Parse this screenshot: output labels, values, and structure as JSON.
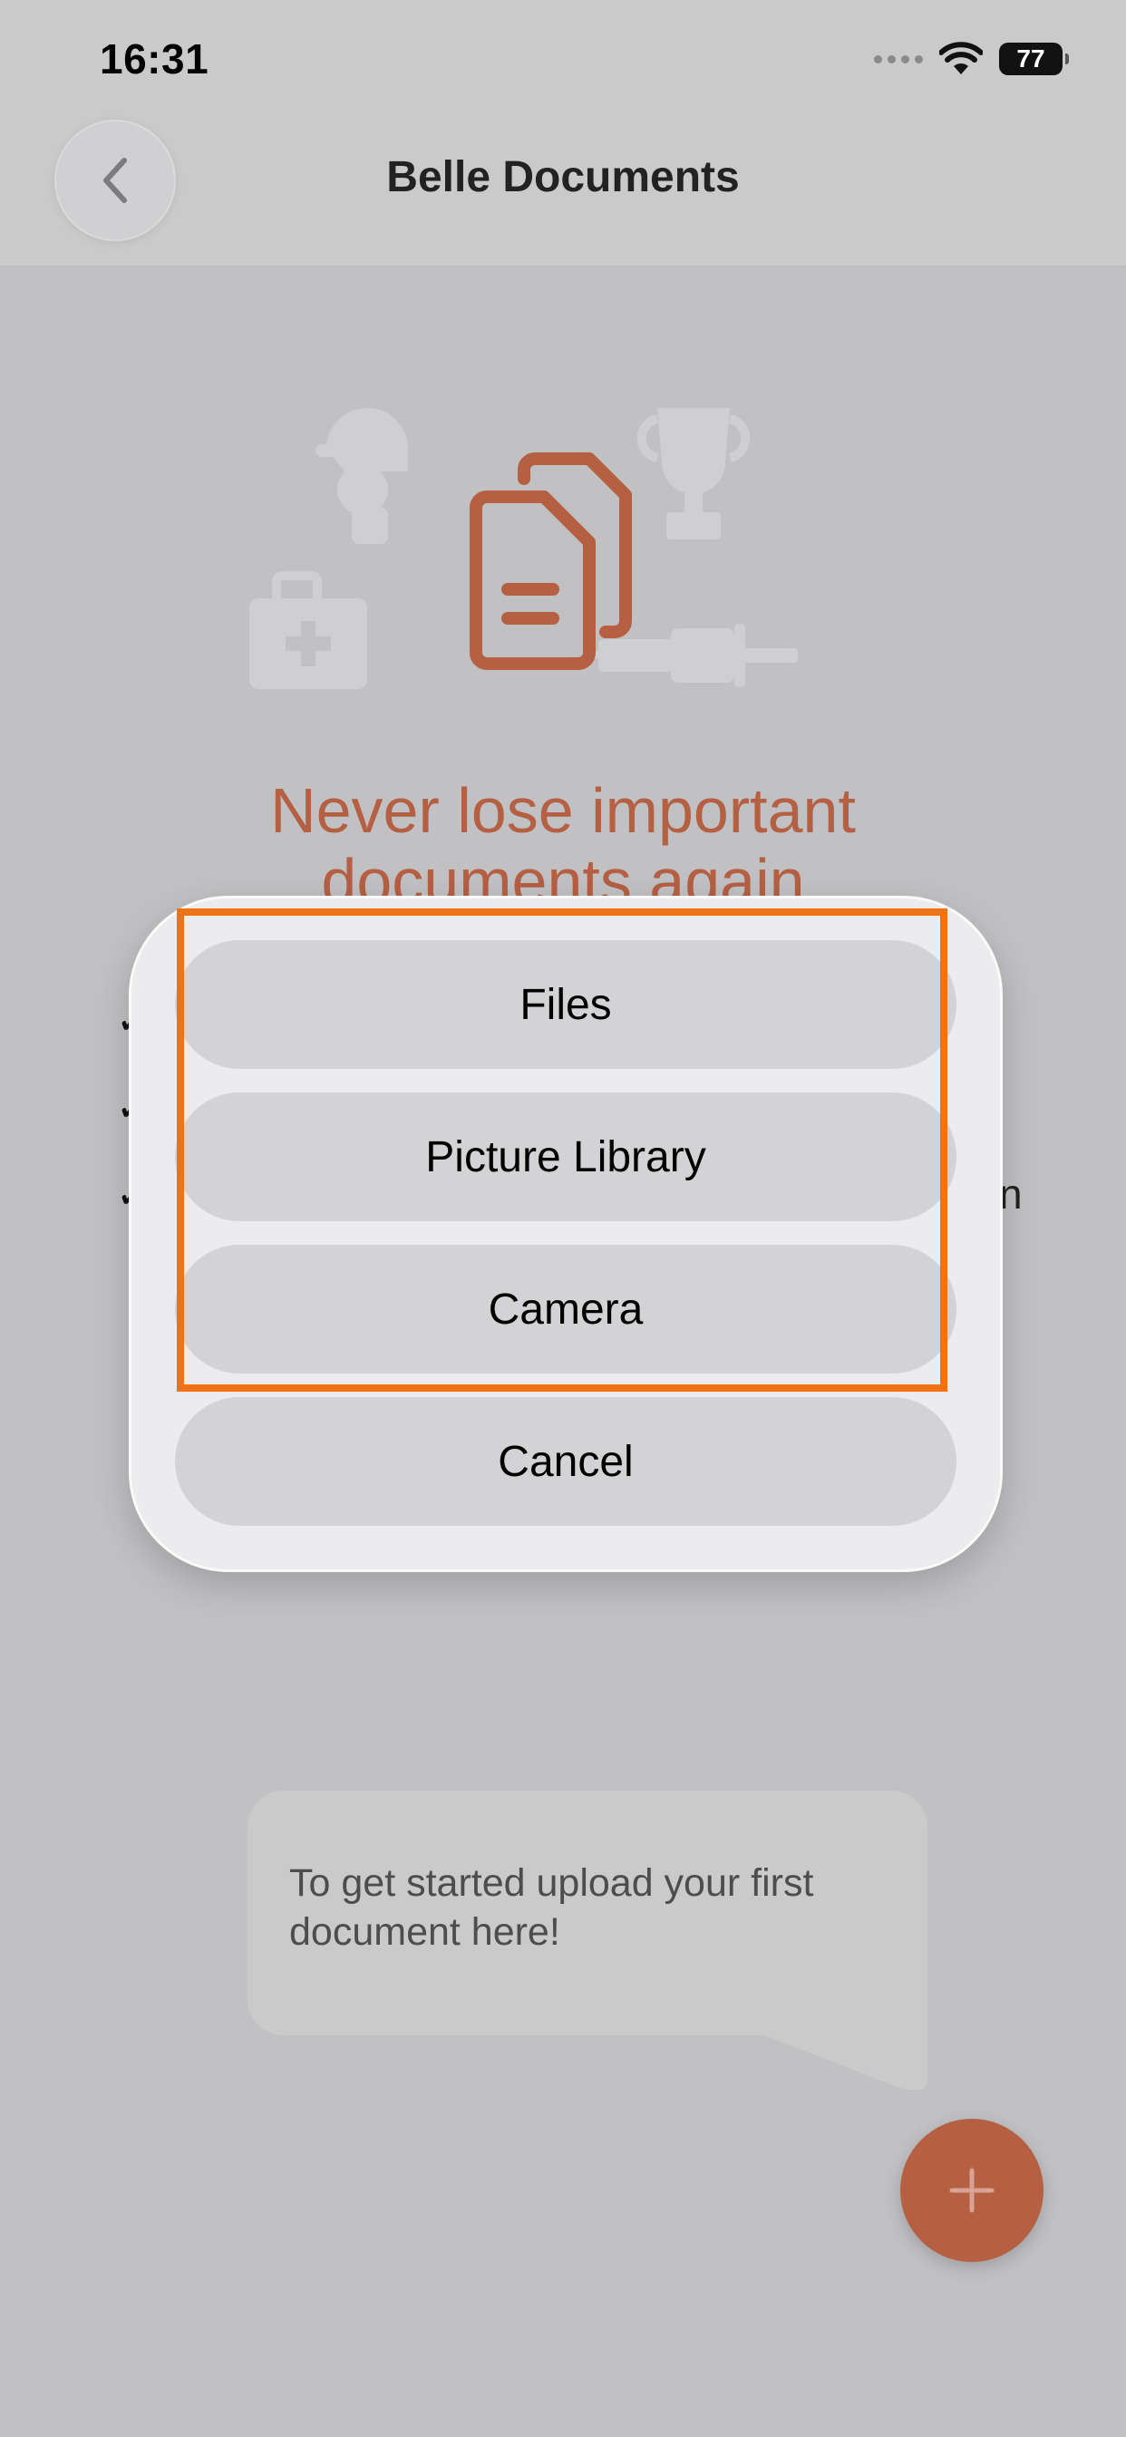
{
  "status_bar": {
    "time": "16:31",
    "battery": "77"
  },
  "nav": {
    "title": "Belle Documents"
  },
  "main": {
    "headline_line1": "Never lose important",
    "headline_line2": "documents again",
    "tooltip": "To get started upload your first document here!",
    "partial_text": "n"
  },
  "action_sheet": {
    "options": [
      {
        "label": "Files"
      },
      {
        "label": "Picture Library"
      },
      {
        "label": "Camera"
      }
    ],
    "cancel_label": "Cancel"
  },
  "colors": {
    "accent": "#b55f43",
    "highlight": "#f07212",
    "background": "#c1c1c4"
  }
}
